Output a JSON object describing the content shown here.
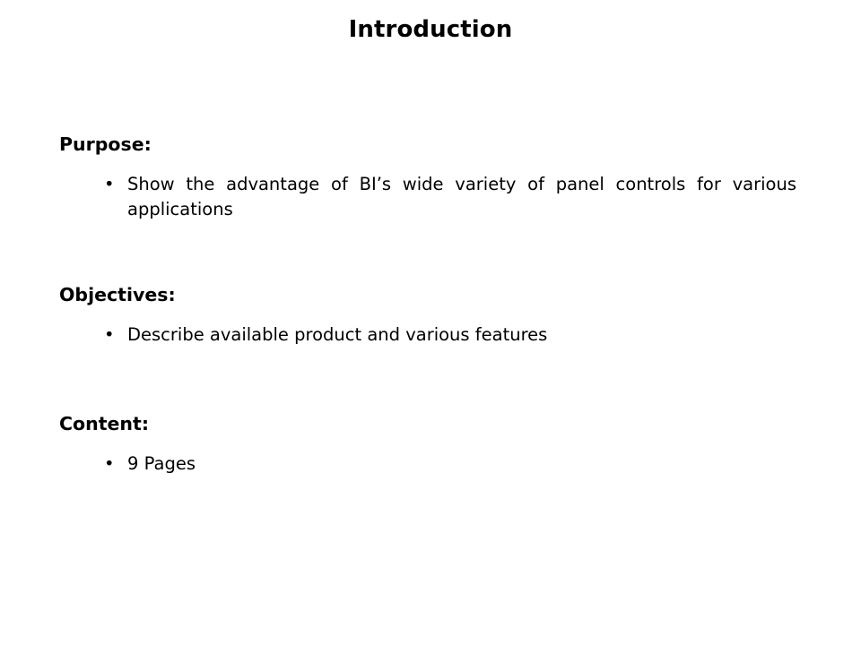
{
  "slide": {
    "title": "Introduction",
    "background_color": "#ffffff",
    "text_color": "#000000",
    "sections": [
      {
        "heading": "Purpose:",
        "bullets": [
          "Show the advantage of BI’s wide variety of panel controls for various applications"
        ]
      },
      {
        "heading": "Objectives:",
        "bullets": [
          "Describe available product and various features"
        ]
      },
      {
        "heading": "Content:",
        "bullets": [
          "9 Pages"
        ]
      }
    ]
  }
}
